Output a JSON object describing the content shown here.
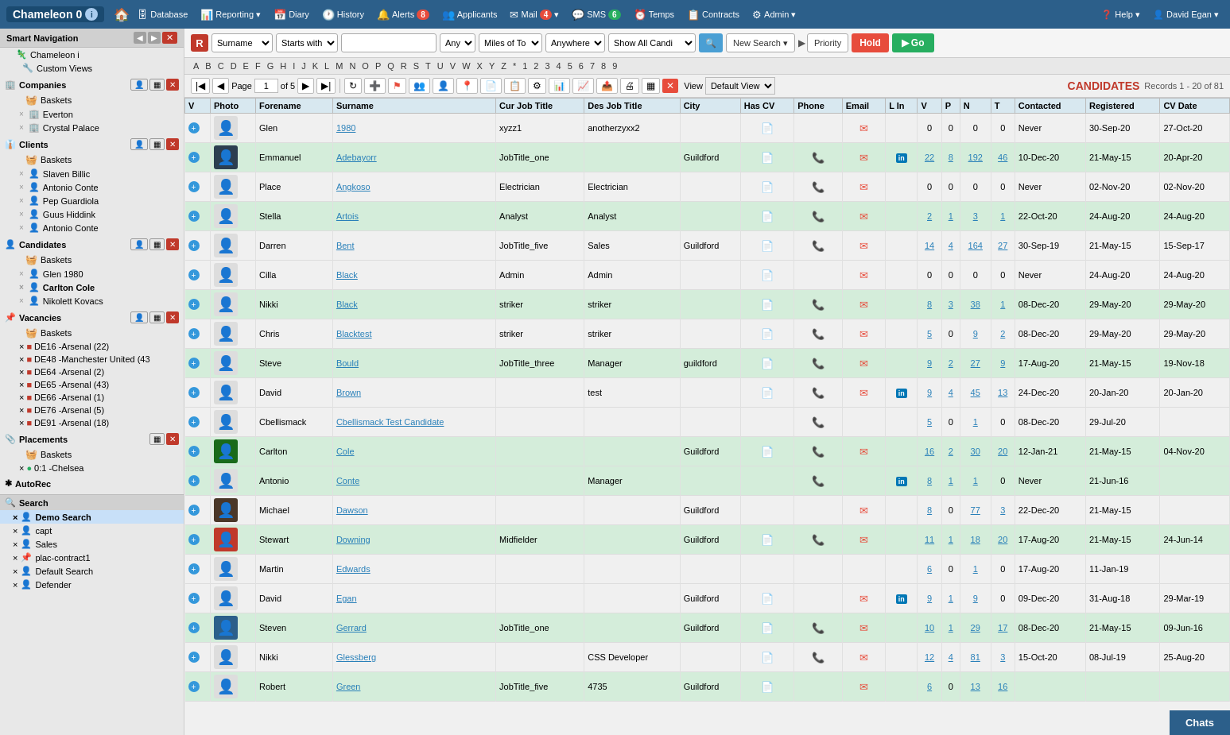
{
  "app": {
    "title": "Chameleon",
    "version": "0"
  },
  "topbar": {
    "logo": "Chameleon 0",
    "nav_items": [
      {
        "label": "Database",
        "icon": "🗄"
      },
      {
        "label": "Reporting",
        "icon": "📊",
        "has_arrow": true
      },
      {
        "label": "Diary",
        "icon": "📅"
      },
      {
        "label": "History",
        "icon": "🕐"
      },
      {
        "label": "Alerts",
        "icon": "🔔",
        "badge": "8"
      },
      {
        "label": "Applicants",
        "icon": "👥"
      },
      {
        "label": "Mail",
        "icon": "✉",
        "badge": "4",
        "has_arrow": true
      },
      {
        "label": "SMS",
        "icon": "💬",
        "badge": "6"
      },
      {
        "label": "Temps",
        "icon": "⏰"
      },
      {
        "label": "Contracts",
        "icon": "📋"
      },
      {
        "label": "Admin",
        "icon": "⚙",
        "has_arrow": true
      }
    ],
    "help": "Help",
    "user": "David Egan"
  },
  "sidebar": {
    "header": "Smart Navigation",
    "chameleon_item": "Chameleon i",
    "custom_views": "Custom Views",
    "sections": [
      {
        "id": "companies",
        "label": "Companies",
        "icon": "🏢",
        "items": [
          {
            "label": "Baskets",
            "type": "basket"
          },
          {
            "label": "Everton",
            "type": "client"
          },
          {
            "label": "Crystal Palace",
            "type": "client"
          }
        ]
      },
      {
        "id": "clients",
        "label": "Clients",
        "icon": "👔",
        "items": [
          {
            "label": "Baskets",
            "type": "basket"
          },
          {
            "label": "Slaven Billic",
            "type": "person"
          },
          {
            "label": "Antonio Conte",
            "type": "person"
          },
          {
            "label": "Pep Guardiola",
            "type": "person"
          },
          {
            "label": "Guus Hiddink",
            "type": "person"
          },
          {
            "label": "Antonio Conte",
            "type": "person"
          }
        ]
      },
      {
        "id": "candidates",
        "label": "Candidates",
        "icon": "👤",
        "items": [
          {
            "label": "Baskets",
            "type": "basket"
          },
          {
            "label": "Glen 1980",
            "type": "person"
          },
          {
            "label": "Carlton Cole",
            "type": "person"
          },
          {
            "label": "Nikolett Kovacs",
            "type": "person"
          }
        ]
      },
      {
        "id": "vacancies",
        "label": "Vacancies",
        "icon": "📌",
        "items": [
          {
            "label": "Baskets",
            "type": "basket"
          },
          {
            "label": "DE16 -Arsenal (22)",
            "flag": "🟥"
          },
          {
            "label": "DE48 -Manchester United (43",
            "flag": "🟥"
          },
          {
            "label": "DE64 -Arsenal (2)",
            "flag": "🟥"
          },
          {
            "label": "DE65 -Arsenal (43)",
            "flag": "🟥"
          },
          {
            "label": "DE66 -Arsenal (1)",
            "flag": "🟥"
          },
          {
            "label": "DE76 -Arsenal (5)",
            "flag": "🟥"
          },
          {
            "label": "DE91 -Arsenal (18)",
            "flag": "🟥"
          }
        ]
      },
      {
        "id": "placements",
        "label": "Placements",
        "icon": "📎",
        "items": [
          {
            "label": "Baskets",
            "type": "basket"
          },
          {
            "label": "0:1 -Chelsea",
            "type": "placement"
          }
        ]
      },
      {
        "id": "autoRec",
        "label": "AutoRec",
        "icon": "🔄"
      }
    ],
    "search": {
      "header": "Search",
      "items": [
        {
          "label": "Demo Search",
          "active": true,
          "icon": "👤"
        },
        {
          "label": "capt",
          "icon": "👤"
        },
        {
          "label": "Sales",
          "icon": "👤"
        },
        {
          "label": "plac-contract1",
          "icon": "📌"
        },
        {
          "label": "Default Search",
          "icon": "👤"
        },
        {
          "label": "Defender",
          "icon": "👤"
        }
      ]
    }
  },
  "searchbar": {
    "badge": "R",
    "field_type": "Surname",
    "condition": "Starts with",
    "value": "",
    "any_label": "Any",
    "miles_label": "Miles of To",
    "location": "Anywhere",
    "show_all": "Show All Candi",
    "new_search_label": "New Search",
    "priority_label": "Priority",
    "hold_label": "Hold",
    "go_label": "Go"
  },
  "alphabet": [
    "A",
    "B",
    "C",
    "D",
    "E",
    "F",
    "G",
    "H",
    "I",
    "J",
    "K",
    "L",
    "M",
    "N",
    "O",
    "P",
    "Q",
    "R",
    "S",
    "T",
    "U",
    "V",
    "W",
    "X",
    "Y",
    "Z",
    "*",
    "1",
    "2",
    "3",
    "4",
    "5",
    "6",
    "7",
    "8",
    "9"
  ],
  "toolbar": {
    "page_label": "Page",
    "page_current": "1",
    "page_total": "5",
    "view_label": "View",
    "default_view": "Default View",
    "candidates_title": "CANDIDATES",
    "records_info": "Records 1 - 20 of 81"
  },
  "table": {
    "columns": [
      "V",
      "Photo",
      "Forename",
      "Surname",
      "Cur Job Title",
      "Des Job Title",
      "City",
      "Has CV",
      "Phone",
      "Email",
      "L In",
      "V",
      "P",
      "N",
      "T",
      "Contacted",
      "Registered",
      "CV Date"
    ],
    "rows": [
      {
        "forename": "Glen",
        "surname": "1980",
        "cur_job": "xyzz1",
        "des_job": "anotherzyxx2",
        "city": "",
        "has_cv": true,
        "phone": false,
        "email": true,
        "linkedin": false,
        "v": "0",
        "p": "0",
        "n": "0",
        "t": "0",
        "contacted": "Never",
        "registered": "30-Sep-20",
        "cv_date": "27-Oct-20",
        "green": false,
        "photo_type": "none"
      },
      {
        "forename": "Emmanuel",
        "surname": "Adebayorr",
        "cur_job": "JobTitle_one",
        "des_job": "",
        "city": "Guildford",
        "has_cv": true,
        "phone": true,
        "email": true,
        "linkedin": true,
        "v": "22",
        "p": "8",
        "n": "192",
        "t": "46",
        "contacted": "10-Dec-20",
        "registered": "21-May-15",
        "cv_date": "20-Apr-20",
        "green": true,
        "photo_type": "dark"
      },
      {
        "forename": "Place",
        "surname": "Angkoso",
        "cur_job": "Electrician",
        "des_job": "Electrician",
        "city": "",
        "has_cv": true,
        "phone": true,
        "email": true,
        "linkedin": false,
        "v": "0",
        "p": "0",
        "n": "0",
        "t": "0",
        "contacted": "Never",
        "registered": "02-Nov-20",
        "cv_date": "02-Nov-20",
        "green": false,
        "photo_type": "none"
      },
      {
        "forename": "Stella",
        "surname": "Artois",
        "cur_job": "Analyst",
        "des_job": "Analyst",
        "city": "",
        "has_cv": true,
        "phone": true,
        "email": true,
        "linkedin": false,
        "v": "2",
        "p": "1",
        "n": "3",
        "t": "1",
        "contacted": "22-Oct-20",
        "registered": "24-Aug-20",
        "cv_date": "24-Aug-20",
        "green": true,
        "photo_type": "none"
      },
      {
        "forename": "Darren",
        "surname": "Bent",
        "cur_job": "JobTitle_five",
        "des_job": "Sales",
        "city": "Guildford",
        "has_cv": true,
        "phone": true,
        "email": true,
        "linkedin": false,
        "v": "14",
        "p": "4",
        "n": "164",
        "t": "27",
        "contacted": "30-Sep-19",
        "registered": "21-May-15",
        "cv_date": "15-Sep-17",
        "green": false,
        "photo_type": "none"
      },
      {
        "forename": "Cilla",
        "surname": "Black",
        "cur_job": "Admin",
        "des_job": "Admin",
        "city": "",
        "has_cv": true,
        "phone": false,
        "email": true,
        "linkedin": false,
        "v": "0",
        "p": "0",
        "n": "0",
        "t": "0",
        "contacted": "Never",
        "registered": "24-Aug-20",
        "cv_date": "24-Aug-20",
        "green": false,
        "photo_type": "none"
      },
      {
        "forename": "Nikki",
        "surname": "Black",
        "cur_job": "striker",
        "des_job": "striker",
        "city": "",
        "has_cv": true,
        "phone": true,
        "email": true,
        "linkedin": false,
        "v": "8",
        "p": "3",
        "n": "38",
        "t": "1",
        "contacted": "08-Dec-20",
        "registered": "29-May-20",
        "cv_date": "29-May-20",
        "green": true,
        "photo_type": "none"
      },
      {
        "forename": "Chris",
        "surname": "Blacktest",
        "cur_job": "striker",
        "des_job": "striker",
        "city": "",
        "has_cv": true,
        "phone": true,
        "email": true,
        "linkedin": false,
        "v": "5",
        "p": "0",
        "n": "9",
        "t": "2",
        "contacted": "08-Dec-20",
        "registered": "29-May-20",
        "cv_date": "29-May-20",
        "green": false,
        "photo_type": "none"
      },
      {
        "forename": "Steve",
        "surname": "Bould",
        "cur_job": "JobTitle_three",
        "des_job": "Manager",
        "city": "guildford",
        "has_cv": true,
        "phone": true,
        "email": true,
        "linkedin": false,
        "v": "9",
        "p": "2",
        "n": "27",
        "t": "9",
        "contacted": "17-Aug-20",
        "registered": "21-May-15",
        "cv_date": "19-Nov-18",
        "green": true,
        "photo_type": "none"
      },
      {
        "forename": "David",
        "surname": "Brown",
        "cur_job": "",
        "des_job": "test",
        "city": "",
        "has_cv": true,
        "phone": true,
        "email": true,
        "linkedin": true,
        "v": "9",
        "p": "4",
        "n": "45",
        "t": "13",
        "contacted": "24-Dec-20",
        "registered": "20-Jan-20",
        "cv_date": "20-Jan-20",
        "green": false,
        "photo_type": "none"
      },
      {
        "forename": "Cbellismack",
        "surname": "Cbellismack Test Candidate",
        "cur_job": "",
        "des_job": "",
        "city": "",
        "has_cv": false,
        "phone": true,
        "email": false,
        "linkedin": false,
        "v": "5",
        "p": "0",
        "n": "1",
        "t": "0",
        "contacted": "08-Dec-20",
        "registered": "29-Jul-20",
        "cv_date": "",
        "green": false,
        "photo_type": "none"
      },
      {
        "forename": "Carlton",
        "surname": "Cole",
        "cur_job": "",
        "des_job": "",
        "city": "Guildford",
        "has_cv": true,
        "phone": true,
        "email": true,
        "linkedin": false,
        "v": "16",
        "p": "2",
        "n": "30",
        "t": "20",
        "contacted": "12-Jan-21",
        "registered": "21-May-15",
        "cv_date": "04-Nov-20",
        "green": true,
        "photo_type": "dark2"
      },
      {
        "forename": "Antonio",
        "surname": "Conte",
        "cur_job": "",
        "des_job": "Manager",
        "city": "",
        "has_cv": false,
        "phone": true,
        "email": false,
        "linkedin": true,
        "v": "8",
        "p": "1",
        "n": "1",
        "t": "0",
        "contacted": "Never",
        "registered": "21-Jun-16",
        "cv_date": "",
        "green": true,
        "photo_type": "none"
      },
      {
        "forename": "Michael",
        "surname": "Dawson",
        "cur_job": "",
        "des_job": "",
        "city": "Guildford",
        "has_cv": false,
        "phone": false,
        "email": true,
        "linkedin": false,
        "v": "8",
        "p": "0",
        "n": "77",
        "t": "3",
        "contacted": "22-Dec-20",
        "registered": "21-May-15",
        "cv_date": "",
        "green": false,
        "photo_type": "dark3"
      },
      {
        "forename": "Stewart",
        "surname": "Downing",
        "cur_job": "Midfielder",
        "des_job": "",
        "city": "Guildford",
        "has_cv": true,
        "phone": true,
        "email": true,
        "linkedin": false,
        "v": "11",
        "p": "1",
        "n": "18",
        "t": "20",
        "contacted": "17-Aug-20",
        "registered": "21-May-15",
        "cv_date": "24-Jun-14",
        "green": true,
        "photo_type": "red"
      },
      {
        "forename": "Martin",
        "surname": "Edwards",
        "cur_job": "",
        "des_job": "",
        "city": "",
        "has_cv": false,
        "phone": false,
        "email": false,
        "linkedin": false,
        "v": "6",
        "p": "0",
        "n": "1",
        "t": "0",
        "contacted": "17-Aug-20",
        "registered": "11-Jan-19",
        "cv_date": "",
        "green": false,
        "photo_type": "none"
      },
      {
        "forename": "David",
        "surname": "Egan",
        "cur_job": "",
        "des_job": "",
        "city": "Guildford",
        "has_cv": true,
        "phone": false,
        "email": true,
        "linkedin": true,
        "v": "9",
        "p": "1",
        "n": "9",
        "t": "0",
        "contacted": "09-Dec-20",
        "registered": "31-Aug-18",
        "cv_date": "29-Mar-19",
        "green": false,
        "photo_type": "none"
      },
      {
        "forename": "Steven",
        "surname": "Gerrard",
        "cur_job": "JobTitle_one",
        "des_job": "",
        "city": "Guildford",
        "has_cv": true,
        "phone": true,
        "email": true,
        "linkedin": false,
        "v": "10",
        "p": "1",
        "n": "29",
        "t": "17",
        "contacted": "08-Dec-20",
        "registered": "21-May-15",
        "cv_date": "09-Jun-16",
        "green": true,
        "photo_type": "dark4"
      },
      {
        "forename": "Nikki",
        "surname": "Glessberg",
        "cur_job": "",
        "des_job": "CSS Developer",
        "city": "",
        "has_cv": true,
        "phone": true,
        "email": true,
        "linkedin": false,
        "v": "12",
        "p": "4",
        "n": "81",
        "t": "3",
        "contacted": "15-Oct-20",
        "registered": "08-Jul-19",
        "cv_date": "25-Aug-20",
        "green": false,
        "photo_type": "none"
      },
      {
        "forename": "Robert",
        "surname": "Green",
        "cur_job": "JobTitle_five",
        "des_job": "4735",
        "city": "Guildford",
        "has_cv": true,
        "phone": false,
        "email": true,
        "linkedin": false,
        "v": "6",
        "p": "0",
        "n": "13",
        "t": "16",
        "contacted": "",
        "registered": "",
        "cv_date": "",
        "green": true,
        "photo_type": "none"
      }
    ]
  },
  "chats": {
    "label": "Chats"
  }
}
